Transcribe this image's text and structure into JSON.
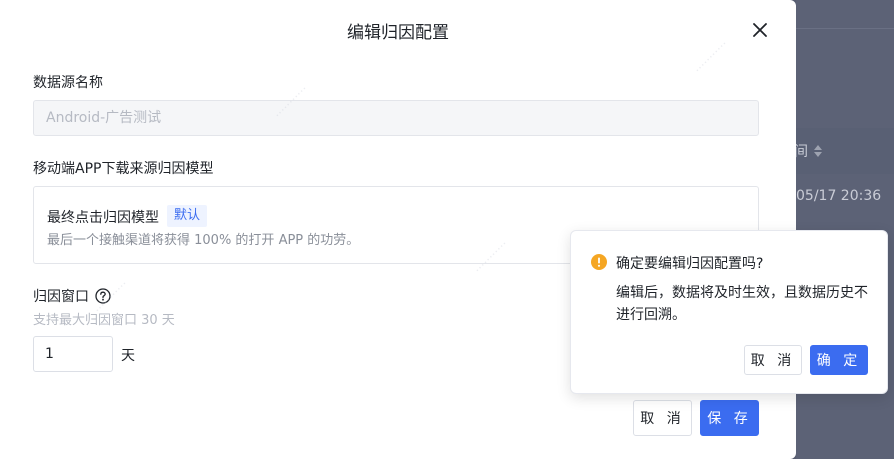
{
  "modal": {
    "title": "编辑归因配置",
    "data_source": {
      "label": "数据源名称",
      "value": "Android-广告测试"
    },
    "model": {
      "label": "移动端APP下载来源归因模型",
      "name": "最终点击归因模型",
      "badge": "默认",
      "description": "最后一个接触渠道将获得 100% 的打开 APP 的功劳。"
    },
    "window": {
      "label": "归因窗口",
      "hint": "支持最大归因窗口 30 天",
      "value": "1",
      "unit": "天"
    },
    "buttons": {
      "cancel": "取 消",
      "save": "保 存"
    }
  },
  "popconfirm": {
    "title": "确定要编辑归因配置吗?",
    "body": "编辑后，数据将及时生效，且数据历史不进行回溯。",
    "cancel": "取 消",
    "confirm": "确 定"
  },
  "background": {
    "column_header": "间",
    "cell_value": "05/17 20:36"
  },
  "colors": {
    "primary": "#3b6cf0",
    "warning": "#f5a623",
    "text": "#1f2329",
    "muted": "#8a8f99"
  }
}
